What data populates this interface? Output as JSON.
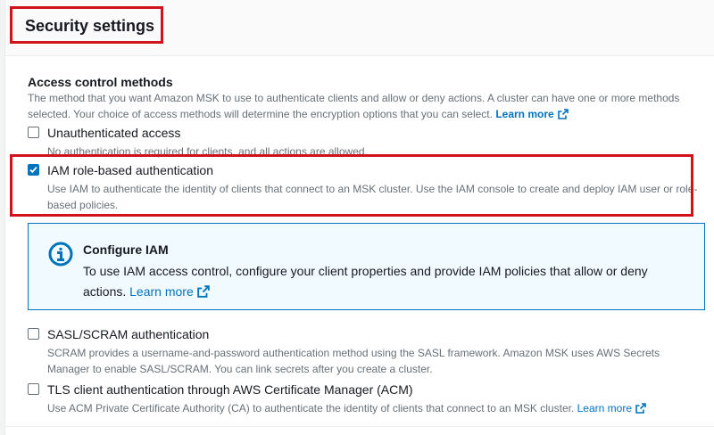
{
  "section": {
    "title": "Security settings"
  },
  "access": {
    "title": "Access control methods",
    "description": "The method that you want Amazon MSK to use to authenticate clients and allow or deny actions. A cluster can have one or more methods selected. Your choice of access methods will determine the encryption options that you can select.",
    "learn_more": "Learn more"
  },
  "options": [
    {
      "label": "Unauthenticated access",
      "description": "No authentication is required for clients, and all actions are allowed.",
      "checked": false
    },
    {
      "label": "IAM role-based authentication",
      "description": "Use IAM to authenticate the identity of clients that connect to an MSK cluster. Use the IAM console to create and deploy IAM user or role-based policies.",
      "checked": true
    },
    {
      "label": "SASL/SCRAM authentication",
      "description": "SCRAM provides a username-and-password authentication method using the SASL framework. Amazon MSK uses AWS Secrets Manager to enable SASL/SCRAM. You can link secrets after you create a cluster.",
      "checked": false
    },
    {
      "label": "TLS client authentication through AWS Certificate Manager (ACM)",
      "description": "Use ACM Private Certificate Authority (CA) to authenticate the identity of clients that connect to an MSK cluster.",
      "learn_more": "Learn more",
      "checked": false
    }
  ],
  "info_box": {
    "icon": "info-icon",
    "title": "Configure IAM",
    "body": "To use IAM access control, configure your client properties and provide IAM policies that allow or deny actions.",
    "learn_more": "Learn more"
  },
  "colors": {
    "accent": "#0073bb",
    "highlight": "#d1111b",
    "info_bg": "#f1faff"
  }
}
